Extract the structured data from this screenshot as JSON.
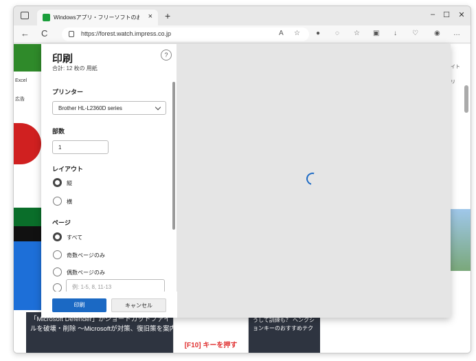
{
  "browser": {
    "tab_title": "Windowsアプリ・フリーソフトのおすす",
    "new_tab": "+",
    "url": "https://forest.watch.impress.co.jp",
    "window_controls": {
      "minimize": "–",
      "maximize": "☐",
      "close": "✕"
    },
    "nav": {
      "back": "←",
      "reload": "C"
    }
  },
  "webpage": {
    "left_labels": [
      "Excel",
      "広告"
    ],
    "right_labels": [
      "イト",
      "リ"
    ],
    "article1_text": "「Microsoft Defender」がショートカットファイルを破壊・削除 ～Microsoftが対策、復旧策を案内",
    "article_img_label": "[F10] キーを押す",
    "article2_text": "うして訓練も？ ヘンクションキーのおすすめテク"
  },
  "print_dialog": {
    "title": "印刷",
    "subtitle": "合計: 12 枚の 用紙",
    "help_label": "?",
    "printer": {
      "label": "プリンター",
      "value": "Brother HL-L2360D series"
    },
    "copies": {
      "label": "部数",
      "value": "1"
    },
    "layout": {
      "label": "レイアウト",
      "options": [
        {
          "label": "縦",
          "checked": true
        },
        {
          "label": "横",
          "checked": false
        }
      ]
    },
    "pages": {
      "label": "ページ",
      "options": [
        {
          "label": "すべて",
          "checked": true
        },
        {
          "label": "奇数ページのみ",
          "checked": false
        },
        {
          "label": "偶数ページのみ",
          "checked": false
        }
      ],
      "range_placeholder": "例: 1-5, 8, 11-13"
    },
    "print_button": "印刷",
    "cancel_button": "キャンセル"
  },
  "colors": {
    "accent": "#1b69c4",
    "preview_bg": "#e5e5e5"
  }
}
